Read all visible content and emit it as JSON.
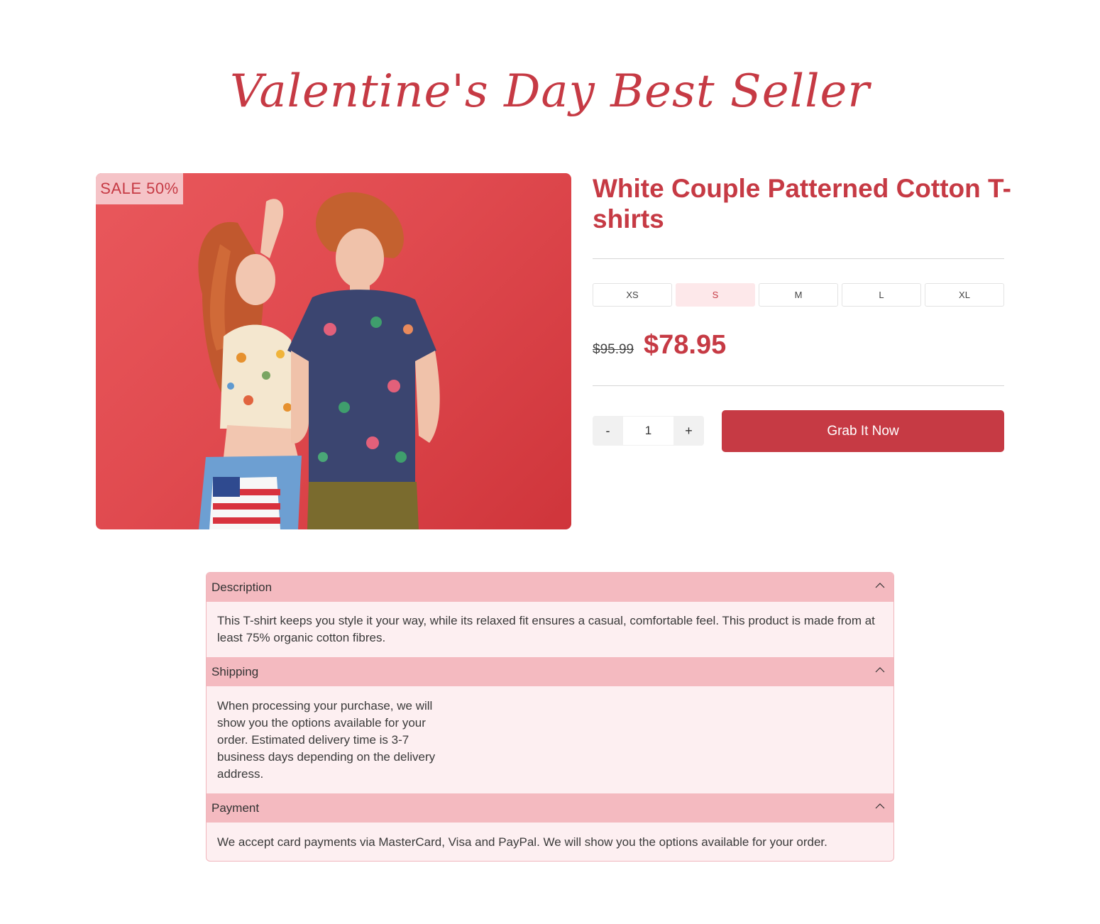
{
  "page": {
    "title": "Valentine's Day Best Seller"
  },
  "product": {
    "badge": "SALE 50%",
    "name": "White Couple Patterned Cotton T-shirts",
    "sizes": [
      "XS",
      "S",
      "M",
      "L",
      "XL"
    ],
    "selected_size": "S",
    "price_old": "$95.99",
    "price_new": "$78.95",
    "quantity": "1",
    "qty_minus": "-",
    "qty_plus": "+",
    "cta_label": "Grab It Now"
  },
  "accordion": {
    "sections": [
      {
        "title": "Description",
        "body": "This T-shirt keeps you style it your way, while its relaxed fit ensures a casual, comfortable feel. This product is made from at least 75% organic cotton fibres.",
        "expanded": true
      },
      {
        "title": "Shipping",
        "body": "When processing your purchase, we will show you the options available for your order. Estimated delivery time is 3-7 business days depending on the delivery address.",
        "expanded": true
      },
      {
        "title": "Payment",
        "body": "We accept card payments via MasterCard, Visa and PayPal. We will show you the options available for your order.",
        "expanded": true
      }
    ]
  },
  "colors": {
    "accent": "#c63a44",
    "badge_bg": "#f5c3c7",
    "accordion_header": "#f4bac0",
    "accordion_body": "#fdeff1",
    "selected_size_bg": "#fde8ea"
  },
  "icons": {
    "accordion_toggle": "chevron-up-icon"
  }
}
